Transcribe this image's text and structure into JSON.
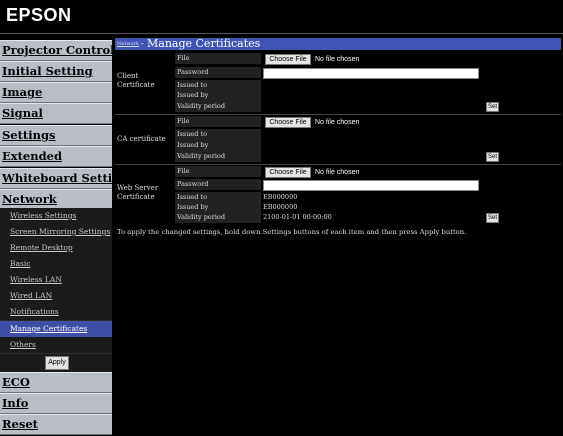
{
  "header": {
    "logo": "EPSON"
  },
  "sidebar": {
    "main_top": [
      "Projector Control",
      "Initial Setting",
      "Image",
      "Signal",
      "Settings",
      "Extended",
      "Whiteboard Settings",
      "Network"
    ],
    "sub": [
      "Wireless Settings",
      "Screen Mirroring Settings",
      "Remote Desktop",
      "Basic",
      "Wireless LAN",
      "Wired LAN",
      "Notifications",
      "Manage Certificates",
      "Others"
    ],
    "active_sub": "Manage Certificates",
    "apply_label": "Apply",
    "main_bottom": [
      "ECO",
      "Info",
      "Reset"
    ]
  },
  "page": {
    "breadcrumb": "Network",
    "separator": "-",
    "title": "Manage Certificates",
    "note": "To apply the changed settings, hold down Settings buttons of each item and then press Apply button."
  },
  "sections": {
    "client": {
      "label": "Client Certificate",
      "file_label": "File",
      "file_button": "Choose File",
      "file_status": "No file chosen",
      "password_label": "Password",
      "issued_to_label": "Issued to",
      "issued_to": "",
      "issued_by_label": "Issued by",
      "issued_by": "",
      "validity_label": "Validity period",
      "validity": "",
      "set_label": "Set"
    },
    "ca": {
      "label": "CA certificate",
      "file_label": "File",
      "file_button": "Choose File",
      "file_status": "No file chosen",
      "issued_to_label": "Issued to",
      "issued_to": "",
      "issued_by_label": "Issued by",
      "issued_by": "",
      "validity_label": "Validity period",
      "validity": "",
      "set_label": "Set"
    },
    "web": {
      "label": "Web Server Certificate",
      "file_label": "File",
      "file_button": "Choose File",
      "file_status": "No file chosen",
      "password_label": "Password",
      "issued_to_label": "Issued to",
      "issued_to": "EB000000",
      "issued_by_label": "Issued by",
      "issued_by": "EB000000",
      "validity_label": "Validity period",
      "validity": "2100-01-01 00:00:00",
      "set_label": "Set"
    }
  },
  "colors": {
    "accent": "#3f55b3",
    "nav_bg": "#b9bdc6",
    "active_sub": "#3d4fa6"
  }
}
